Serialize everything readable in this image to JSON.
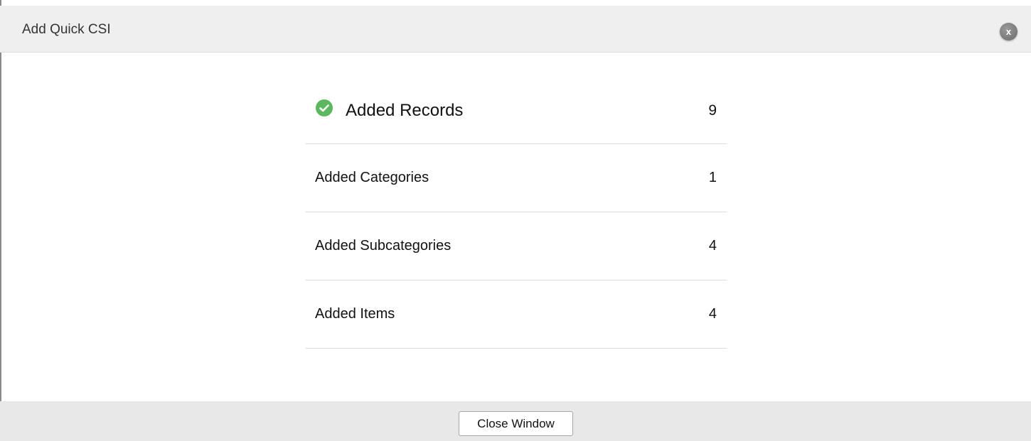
{
  "dialog": {
    "title": "Add Quick CSI",
    "close_icon_glyph": "x"
  },
  "summary": {
    "rows": [
      {
        "label": "Added Records",
        "value": "9",
        "icon": "check-circle-icon"
      },
      {
        "label": "Added Categories",
        "value": "1"
      },
      {
        "label": "Added Subcategories",
        "value": "4"
      },
      {
        "label": "Added Items",
        "value": "4"
      }
    ]
  },
  "footer": {
    "close_button_label": "Close Window"
  },
  "colors": {
    "success_green": "#5cb85c",
    "header_bg": "#efefef",
    "footer_bg": "#e8e8e8"
  }
}
